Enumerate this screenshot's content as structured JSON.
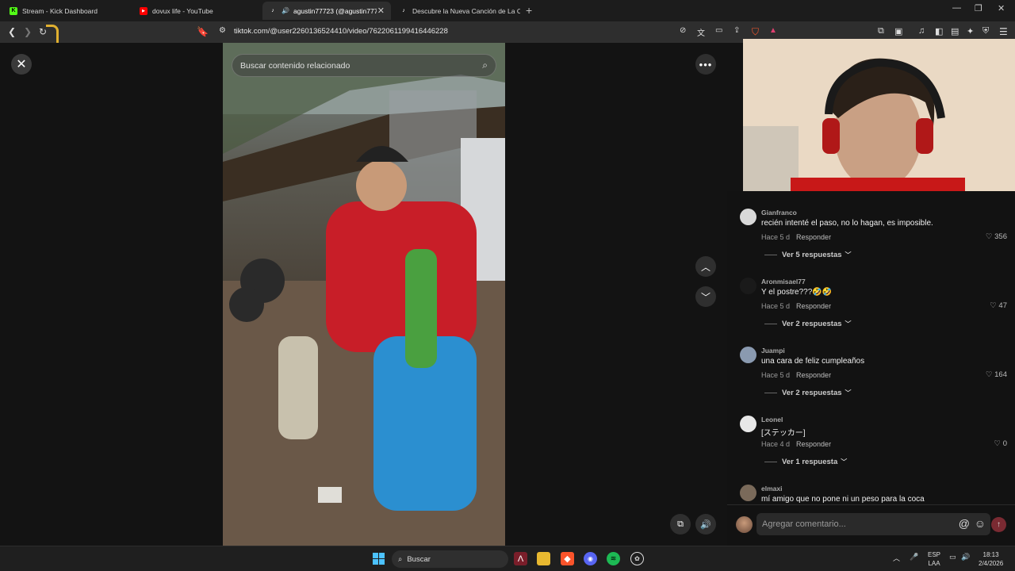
{
  "tabs": [
    {
      "title": "Stream - Kick Dashboard",
      "icon": "kick-icon",
      "fav_bg": "#53fc18",
      "fav_text": "K"
    },
    {
      "title": "dovux life - YouTube",
      "icon": "youtube-icon",
      "fav_bg": "#ff0000",
      "fav_text": "▶"
    },
    {
      "title": "agustin77723 (@agustin7772",
      "icon": "tiktok-icon",
      "fav_bg": "#2e2e2e",
      "fav_text": "♪",
      "active": true
    },
    {
      "title": "Descubre la Nueva Canción de La Co",
      "icon": "tiktok-icon",
      "fav_bg": "#1c1c1c",
      "fav_text": "♪"
    }
  ],
  "toolbar": {
    "url": "tiktok.com/@user2260136524410/video/7622061199416446228"
  },
  "video": {
    "search_placeholder": "Buscar contenido relacionado"
  },
  "comments": [
    {
      "user": "Gianfranco",
      "text": "recién intenté el paso, no lo hagan, es imposible.",
      "time": "Hace 5 d",
      "reply": "Responder",
      "likes": "356",
      "replies": "Ver 5 respuestas",
      "avatar_color": "#d8d8d8"
    },
    {
      "user": "Aronmisael77",
      "text": "Y el postre???🤣🤣",
      "time": "Hace 5 d",
      "reply": "Responder",
      "likes": "47",
      "replies": "Ver 2 respuestas",
      "avatar_color": "#1a1a1a"
    },
    {
      "user": "Juampi",
      "text": "una cara de feliz cumpleaños",
      "time": "Hace 5 d",
      "reply": "Responder",
      "likes": "164",
      "replies": "Ver 2 respuestas",
      "avatar_color": "#8a9ab0"
    },
    {
      "user": "Leonel",
      "text": "[ステッカー]",
      "time": "Hace 4 d",
      "reply": "Responder",
      "likes": "0",
      "replies": "Ver 1 respuesta",
      "avatar_color": "#e8e8e8"
    },
    {
      "user": "elmaxi",
      "text": "mí amigo que no pone ni un peso para la coca",
      "avatar_color": "#7a6a5a"
    }
  ],
  "add_comment": {
    "placeholder": "Agregar comentario..."
  },
  "taskbar": {
    "search_label": "Buscar",
    "lang_top": "ESP",
    "lang_bottom": "LAA",
    "time": "18:13",
    "date": "2/4/2026"
  }
}
